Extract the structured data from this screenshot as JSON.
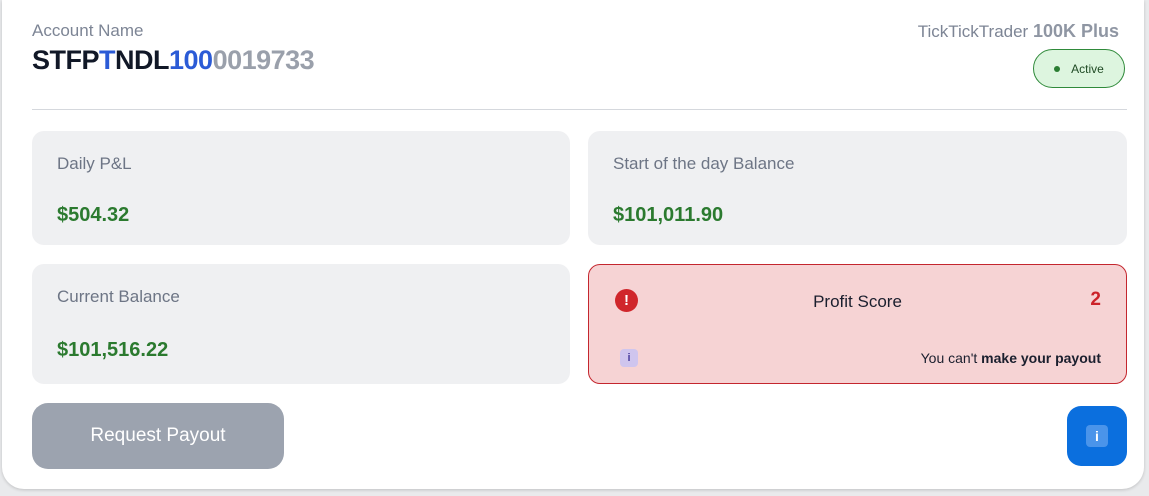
{
  "account": {
    "label": "Account Name",
    "number_parts": [
      "STFP",
      "T",
      "NDL",
      "100",
      "0019733"
    ]
  },
  "plan": {
    "provider": "TickTickTrader",
    "name": "100K Plus"
  },
  "status": {
    "label": "Active",
    "color": "#2f8a3a"
  },
  "stats": {
    "daily_pnl": {
      "label": "Daily P&L",
      "value": "$504.32"
    },
    "start_of_day_balance": {
      "label": "Start of the day Balance",
      "value": "$101,011.90"
    },
    "current_balance": {
      "label": "Current Balance",
      "value": "$101,516.22"
    }
  },
  "profit_score": {
    "label": "Profit Score",
    "score": "2",
    "message_prefix": "You can't ",
    "message_bold": "make your payout",
    "alert_icon": "exclamation-circle-icon",
    "info_icon": "info-icon",
    "color": "#c4262e"
  },
  "actions": {
    "request_payout_label": "Request Payout",
    "info_button_icon": "info-icon",
    "accent_color": "#0b6fde"
  }
}
